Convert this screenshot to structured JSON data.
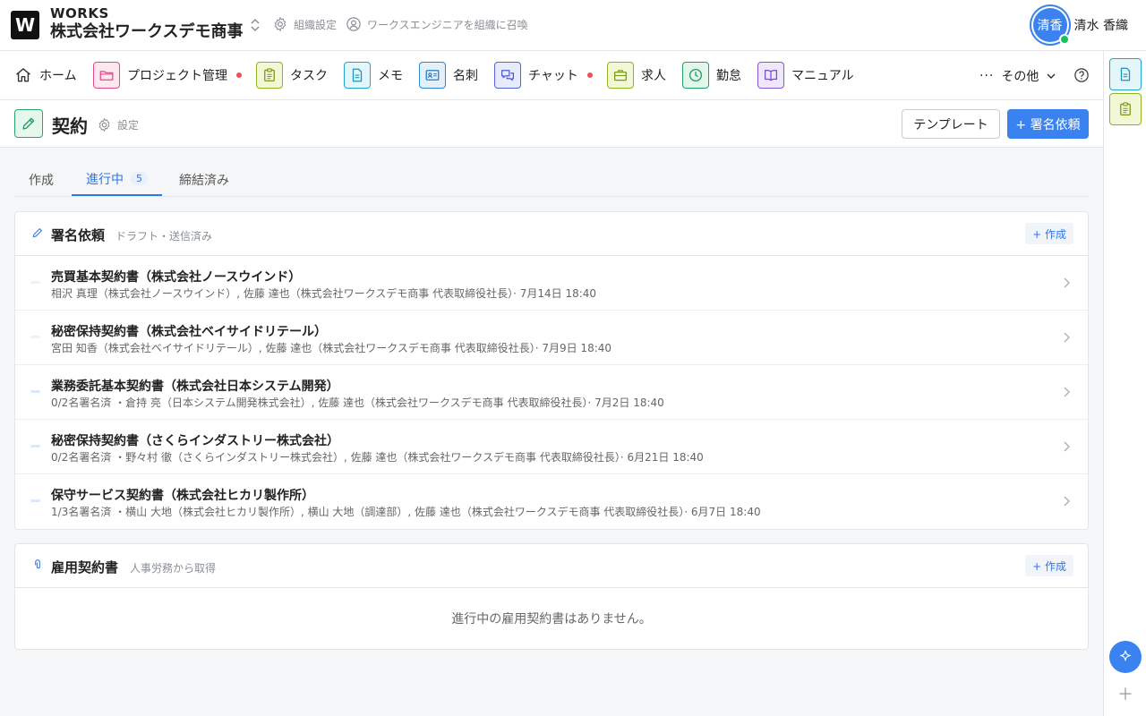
{
  "header": {
    "logo_letter": "W",
    "brand_small": "WORKS",
    "org_name": "株式会社ワークスデモ商事",
    "org_settings_label": "組織設定",
    "invite_label": "ワークスエンジニアを組織に召喚",
    "user": {
      "avatar_text": "清香",
      "name": "清水 香織",
      "status": "online"
    }
  },
  "nav": {
    "items": [
      {
        "label": "ホーム",
        "icon": "home-icon"
      },
      {
        "label": "プロジェクト管理",
        "icon": "folder-icon",
        "badge": true
      },
      {
        "label": "タスク",
        "icon": "clipboard-icon"
      },
      {
        "label": "メモ",
        "icon": "memo-icon"
      },
      {
        "label": "名刺",
        "icon": "business-card-icon"
      },
      {
        "label": "チャット",
        "icon": "chat-icon",
        "badge": true
      },
      {
        "label": "求人",
        "icon": "briefcase-icon"
      },
      {
        "label": "勤怠",
        "icon": "clock-icon"
      },
      {
        "label": "マニュアル",
        "icon": "book-icon"
      }
    ],
    "more_label": "その他"
  },
  "page": {
    "title": "契約",
    "settings_label": "設定",
    "template_button": "テンプレート",
    "sign_request_button": "+ 署名依頼"
  },
  "tabs": [
    {
      "label": "作成"
    },
    {
      "label": "進行中",
      "count": "5",
      "active": true
    },
    {
      "label": "締結済み"
    }
  ],
  "sign_requests": {
    "title": "署名依頼",
    "subtitle": "ドラフト・送信済み",
    "create_label": "+ 作成",
    "rows": [
      {
        "title": "売買基本契約書（株式会社ノースウインド）",
        "meta": "相沢 真理（株式会社ノースウインド）, 佐藤 達也（株式会社ワークスデモ商事 代表取締役社長）· 7月14日 18:40",
        "marker": "gray"
      },
      {
        "title": "秘密保持契約書（株式会社ベイサイドリテール）",
        "meta": "宮田 知香（株式会社ベイサイドリテール）, 佐藤 達也（株式会社ワークスデモ商事 代表取締役社長）· 7月9日 18:40",
        "marker": "gray"
      },
      {
        "title": "業務委託基本契約書（株式会社日本システム開発）",
        "meta": "0/2名署名済 ・倉持 亮（日本システム開発株式会社）, 佐藤 達也（株式会社ワークスデモ商事 代表取締役社長）· 7月2日 18:40",
        "marker": "blue"
      },
      {
        "title": "秘密保持契約書（さくらインダストリー株式会社）",
        "meta": "0/2名署名済 ・野々村 徹（さくらインダストリー株式会社）, 佐藤 達也（株式会社ワークスデモ商事 代表取締役社長）· 6月21日 18:40",
        "marker": "blue"
      },
      {
        "title": "保守サービス契約書（株式会社ヒカリ製作所）",
        "meta": "1/3名署名済 ・横山 大地（株式会社ヒカリ製作所）, 横山 大地（調達部）, 佐藤 達也（株式会社ワークスデモ商事 代表取締役社長）· 6月7日 18:40",
        "marker": "blue"
      }
    ]
  },
  "employment": {
    "title": "雇用契約書",
    "subtitle": "人事労務から取得",
    "create_label": "+ 作成",
    "empty_text": "進行中の雇用契約書はありません。"
  },
  "colors": {
    "accent": "#3a82f0",
    "badge": "#f04e4e",
    "online": "#18c05a"
  }
}
